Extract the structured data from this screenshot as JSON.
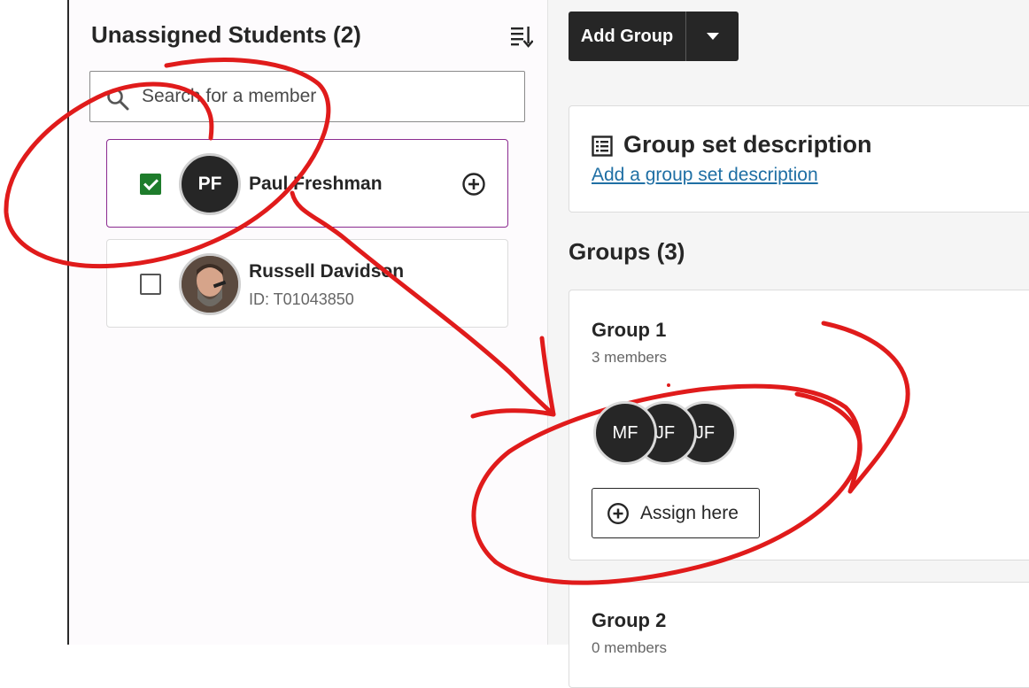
{
  "unassigned": {
    "title": "Unassigned Students (2)",
    "search_placeholder": "Search for a member",
    "students": [
      {
        "initials": "PF",
        "name": "Paul Freshman",
        "checked": true
      },
      {
        "initials": "",
        "name": "Russell Davidson",
        "id": "ID: T01043850",
        "checked": false
      }
    ]
  },
  "toolbar": {
    "add_group_label": "Add Group"
  },
  "description": {
    "title": "Group set description",
    "link": "Add a group set description"
  },
  "groups": {
    "heading": "Groups (3)",
    "items": [
      {
        "name": "Group 1",
        "count": "3 members",
        "members": [
          "MF",
          "JF",
          "JF"
        ],
        "assign_label": "Assign here"
      },
      {
        "name": "Group 2",
        "count": "0 members"
      }
    ]
  },
  "colors": {
    "annotation": "#e01b1b",
    "checkbox": "#1e7c2b",
    "selected_border": "#8b2a90",
    "link": "#1f6fa4"
  }
}
